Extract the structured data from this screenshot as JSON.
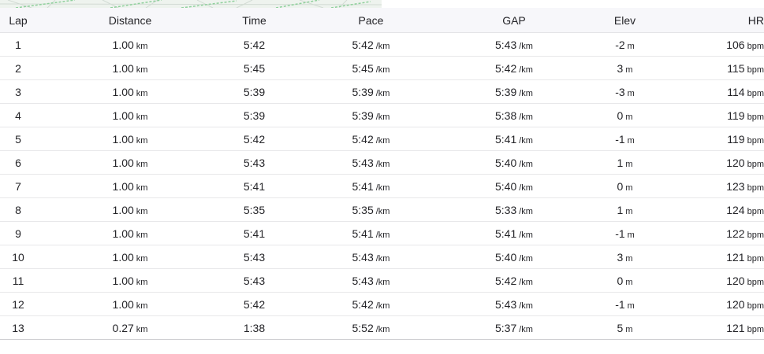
{
  "map": {
    "colors": {
      "background": "#eef3ee",
      "route": "#8fd09c",
      "streets": "#d2dbd4"
    }
  },
  "table": {
    "headers": {
      "lap": "Lap",
      "distance": "Distance",
      "time": "Time",
      "pace": "Pace",
      "gap": "GAP",
      "elev": "Elev",
      "hr": "HR"
    },
    "units": {
      "distance": "km",
      "pace": "/km",
      "gap": "/km",
      "elev": "m",
      "hr": "bpm"
    },
    "rows": [
      {
        "lap": "1",
        "distance": "1.00",
        "time": "5:42",
        "pace": "5:42",
        "gap": "5:43",
        "elev": "-2",
        "hr": "106"
      },
      {
        "lap": "2",
        "distance": "1.00",
        "time": "5:45",
        "pace": "5:45",
        "gap": "5:42",
        "elev": "3",
        "hr": "115"
      },
      {
        "lap": "3",
        "distance": "1.00",
        "time": "5:39",
        "pace": "5:39",
        "gap": "5:39",
        "elev": "-3",
        "hr": "114"
      },
      {
        "lap": "4",
        "distance": "1.00",
        "time": "5:39",
        "pace": "5:39",
        "gap": "5:38",
        "elev": "0",
        "hr": "119"
      },
      {
        "lap": "5",
        "distance": "1.00",
        "time": "5:42",
        "pace": "5:42",
        "gap": "5:41",
        "elev": "-1",
        "hr": "119"
      },
      {
        "lap": "6",
        "distance": "1.00",
        "time": "5:43",
        "pace": "5:43",
        "gap": "5:40",
        "elev": "1",
        "hr": "120"
      },
      {
        "lap": "7",
        "distance": "1.00",
        "time": "5:41",
        "pace": "5:41",
        "gap": "5:40",
        "elev": "0",
        "hr": "123"
      },
      {
        "lap": "8",
        "distance": "1.00",
        "time": "5:35",
        "pace": "5:35",
        "gap": "5:33",
        "elev": "1",
        "hr": "124"
      },
      {
        "lap": "9",
        "distance": "1.00",
        "time": "5:41",
        "pace": "5:41",
        "gap": "5:41",
        "elev": "-1",
        "hr": "122"
      },
      {
        "lap": "10",
        "distance": "1.00",
        "time": "5:43",
        "pace": "5:43",
        "gap": "5:40",
        "elev": "3",
        "hr": "121"
      },
      {
        "lap": "11",
        "distance": "1.00",
        "time": "5:43",
        "pace": "5:43",
        "gap": "5:42",
        "elev": "0",
        "hr": "120"
      },
      {
        "lap": "12",
        "distance": "1.00",
        "time": "5:42",
        "pace": "5:42",
        "gap": "5:43",
        "elev": "-1",
        "hr": "120"
      },
      {
        "lap": "13",
        "distance": "0.27",
        "time": "1:38",
        "pace": "5:52",
        "gap": "5:37",
        "elev": "5",
        "hr": "121"
      }
    ]
  }
}
